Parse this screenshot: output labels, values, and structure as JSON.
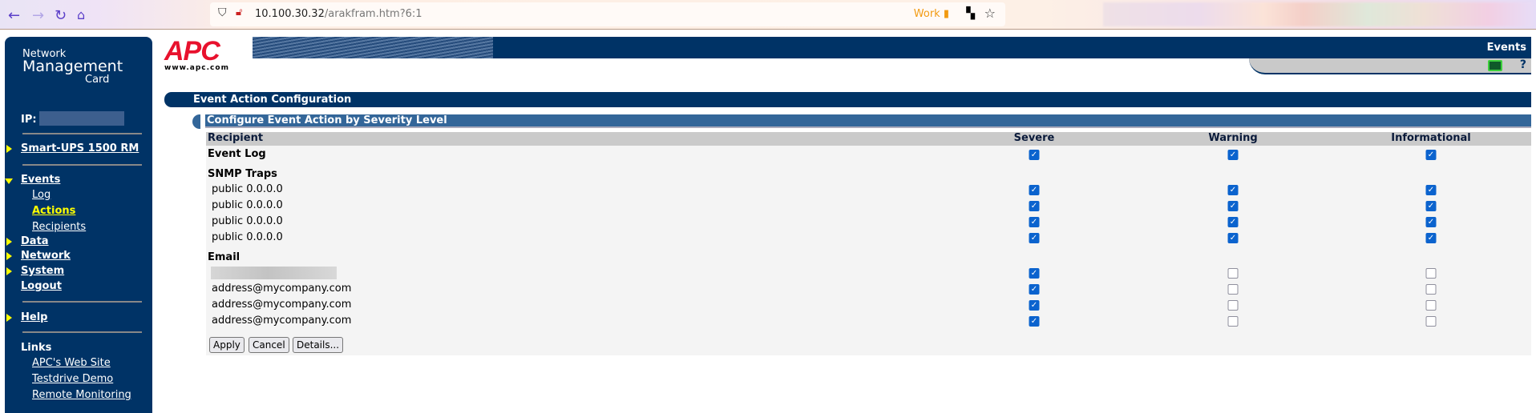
{
  "browser": {
    "url_host": "10.100.30.32",
    "url_path": "/arakfram.htm?6:1",
    "container_label": "Work"
  },
  "sidebar": {
    "title_line1": "Network",
    "title_line2": "Management",
    "title_line3": "Card",
    "ip_label": "IP:",
    "device": "Smart-UPS 1500 RM",
    "events": "Events",
    "log": "Log",
    "actions": "Actions",
    "recipients": "Recipients",
    "data": "Data",
    "network": "Network",
    "system": "System",
    "logout": "Logout",
    "help": "Help",
    "links": "Links",
    "link_items": [
      "APC's Web Site",
      "Testdrive Demo",
      "Remote Monitoring"
    ],
    "active_color": "#ffff00"
  },
  "header": {
    "logo": "APC",
    "logo_url": "www.apc.com",
    "section": "Events"
  },
  "page": {
    "title": "Event Action Configuration",
    "subtitle": "Configure Event Action by Severity Level"
  },
  "table": {
    "columns": [
      "Recipient",
      "Severe",
      "Warning",
      "Informational"
    ],
    "event_log": {
      "label": "Event Log",
      "checks": [
        true,
        true,
        true
      ]
    },
    "snmp": {
      "label": "SNMP Traps",
      "rows": [
        {
          "label": "public 0.0.0.0",
          "checks": [
            true,
            true,
            true
          ]
        },
        {
          "label": "public 0.0.0.0",
          "checks": [
            true,
            true,
            true
          ]
        },
        {
          "label": "public 0.0.0.0",
          "checks": [
            true,
            true,
            true
          ]
        },
        {
          "label": "public 0.0.0.0",
          "checks": [
            true,
            true,
            true
          ]
        }
      ]
    },
    "email": {
      "label": "Email",
      "rows": [
        {
          "label": "",
          "checks": [
            true,
            false,
            false
          ]
        },
        {
          "label": "address@mycompany.com",
          "checks": [
            true,
            false,
            false
          ]
        },
        {
          "label": "address@mycompany.com",
          "checks": [
            true,
            false,
            false
          ]
        },
        {
          "label": "address@mycompany.com",
          "checks": [
            true,
            false,
            false
          ]
        }
      ]
    }
  },
  "buttons": {
    "apply": "Apply",
    "cancel": "Cancel",
    "details": "Details..."
  },
  "colors": {
    "navy": "#003366",
    "subbar": "#336699",
    "apc_red": "#e8112d",
    "checkbox": "#0b63ce"
  }
}
